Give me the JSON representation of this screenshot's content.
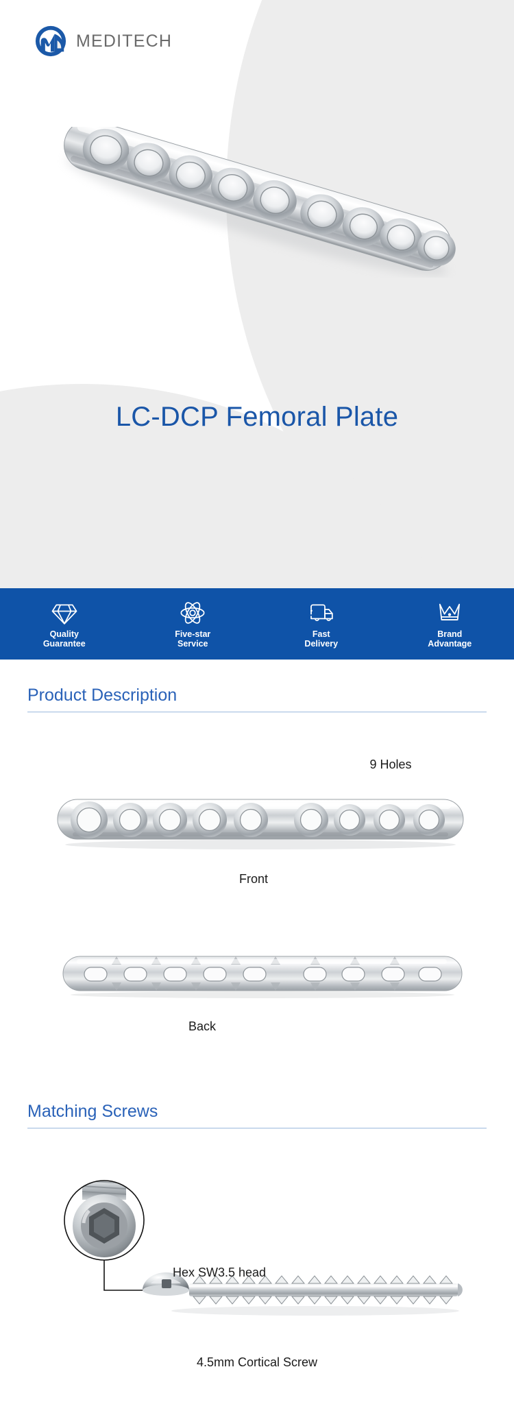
{
  "brand": {
    "logo_icon": "meditech-logo-mark",
    "name": "MEDITECH",
    "accent_color": "#1a56a8",
    "banner_color": "#0f53a8"
  },
  "hero": {
    "product_image_alt": "lc-dcp-femoral-plate-photo",
    "title": "LC-DCP Femoral Plate",
    "background_color": "#ededed"
  },
  "features": [
    {
      "icon": "diamond-icon",
      "label": "Quality\nGuarantee"
    },
    {
      "icon": "atom-icon",
      "label": "Five-star\nService"
    },
    {
      "icon": "truck-icon",
      "label": "Fast\nDelivery"
    },
    {
      "icon": "crown-icon",
      "label": "Brand\nAdvantage"
    }
  ],
  "sections": [
    {
      "title": "Product Description"
    },
    {
      "title": "Matching Screws"
    }
  ],
  "product_description": {
    "holes_label": "9 Holes",
    "front_label": "Front",
    "back_label": "Back",
    "front_image_alt": "plate-front-view",
    "back_image_alt": "plate-back-view"
  },
  "matching_screws": {
    "head_callout": "Hex SW3.5 head",
    "screw_label": "4.5mm Cortical Screw",
    "magnifier_alt": "screw-head-magnifier",
    "screw_image_alt": "cortical-screw-photo"
  }
}
